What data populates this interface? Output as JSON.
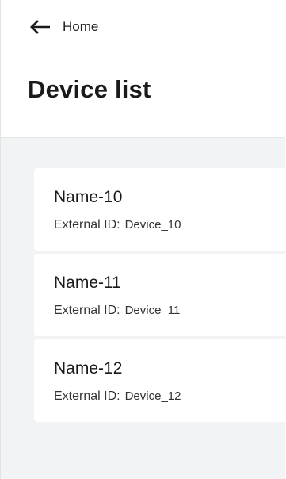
{
  "header": {
    "back_label": "Home",
    "title": "Device list"
  },
  "devices": [
    {
      "name": "Name-10",
      "external_id_label": "External ID:",
      "external_id": "Device_10"
    },
    {
      "name": "Name-11",
      "external_id_label": "External ID:",
      "external_id": "Device_11"
    },
    {
      "name": "Name-12",
      "external_id_label": "External ID:",
      "external_id": "Device_12"
    }
  ],
  "icons": {
    "back": "arrow-left-icon"
  },
  "colors": {
    "background": "#ffffff",
    "content_background": "#f1f3f5",
    "text": "#1a1a1a"
  }
}
